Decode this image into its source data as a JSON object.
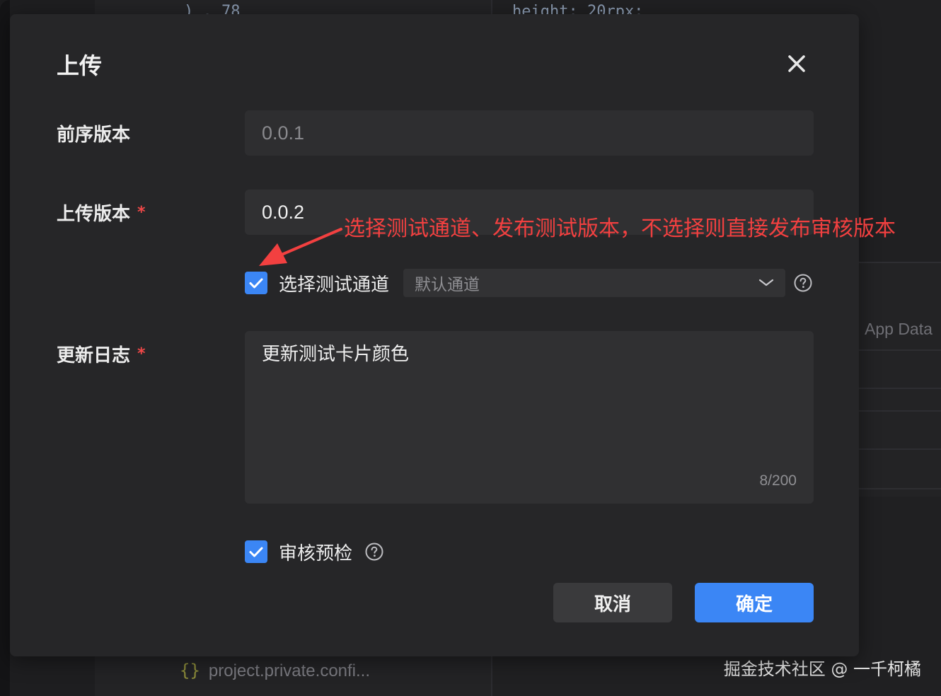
{
  "background": {
    "code_line_left": ")  .  78",
    "code_line_right": "height: 20rpx;",
    "right_panel_label": "App Data",
    "file_name": "project.private.confi...",
    "file_icon": "{}"
  },
  "dialog": {
    "title": "上传",
    "close_icon": "close-icon",
    "previous_version": {
      "label": "前序版本",
      "value": "0.0.1"
    },
    "upload_version": {
      "label": "上传版本",
      "required_mark": "*",
      "value": "0.0.2"
    },
    "test_channel": {
      "checked": true,
      "label": "选择测试通道",
      "select_value": "默认通道"
    },
    "changelog": {
      "label": "更新日志",
      "required_mark": "*",
      "value": "更新测试卡片颜色",
      "char_count": "8/200"
    },
    "review_precheck": {
      "checked": true,
      "label": "审核预检"
    },
    "buttons": {
      "cancel": "取消",
      "confirm": "确定"
    }
  },
  "annotation": {
    "text": "选择测试通道、发布测试版本，不选择则直接发布审核版本",
    "color": "#f24040"
  },
  "watermark": "掘金技术社区 @ 一千柯橘",
  "colors": {
    "accent": "#3b86f5",
    "required": "#f04848",
    "dialog_bg": "#262628",
    "input_bg": "#303032"
  }
}
